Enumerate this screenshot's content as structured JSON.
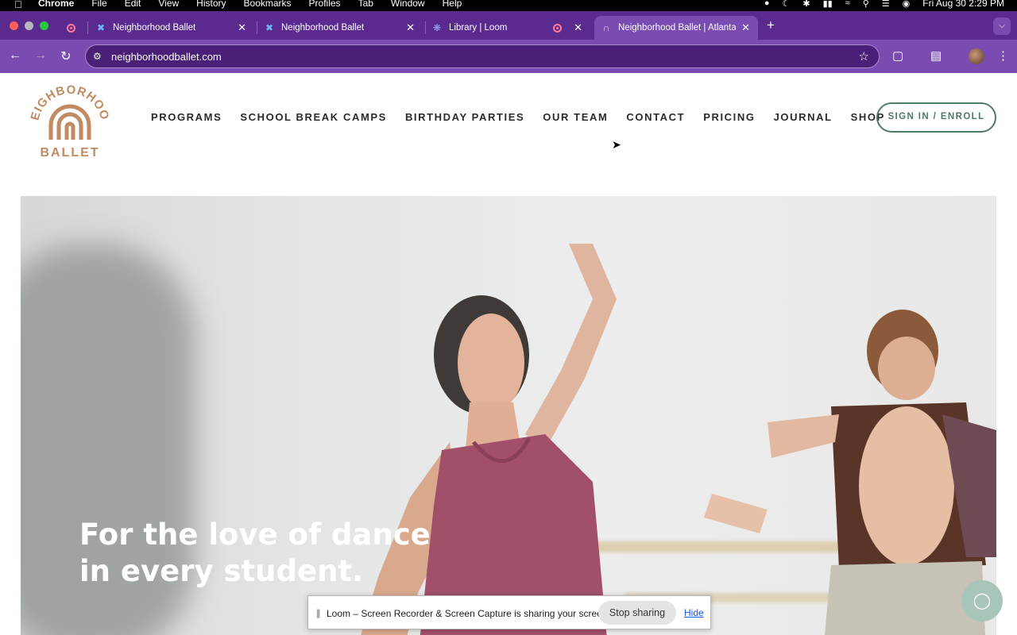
{
  "menubar": {
    "apple": "",
    "items": [
      "Chrome",
      "File",
      "Edit",
      "View",
      "History",
      "Bookmarks",
      "Profiles",
      "Tab",
      "Window",
      "Help"
    ],
    "datetime": "Fri Aug 30  2:29 PM"
  },
  "tabs": [
    {
      "title": "Neighborhood Ballet",
      "active": false
    },
    {
      "title": "Neighborhood Ballet",
      "active": false
    },
    {
      "title": "Library | Loom",
      "active": false
    },
    {
      "title": "Neighborhood Ballet | Atlanta",
      "active": true
    }
  ],
  "toolbar": {
    "url": "neighborhoodballet.com"
  },
  "site": {
    "logo_top": "NEIGHBORHOOD",
    "logo_bottom": "BALLET",
    "nav": [
      "PROGRAMS",
      "SCHOOL BREAK CAMPS",
      "BIRTHDAY PARTIES",
      "OUR TEAM",
      "CONTACT",
      "PRICING",
      "JOURNAL",
      "SHOP"
    ],
    "cta": "SIGN IN / ENROLL",
    "hero_line1": "For the love of dance",
    "hero_line2": "in every student.",
    "brand_color": "#c08a63",
    "accent_color": "#4e7a66"
  },
  "loom": {
    "message": "Loom – Screen Recorder & Screen Capture is sharing your screen.",
    "stop_label": "Stop sharing",
    "hide_label": "Hide"
  },
  "icons": {
    "chat": "chat-bubble-icon"
  }
}
